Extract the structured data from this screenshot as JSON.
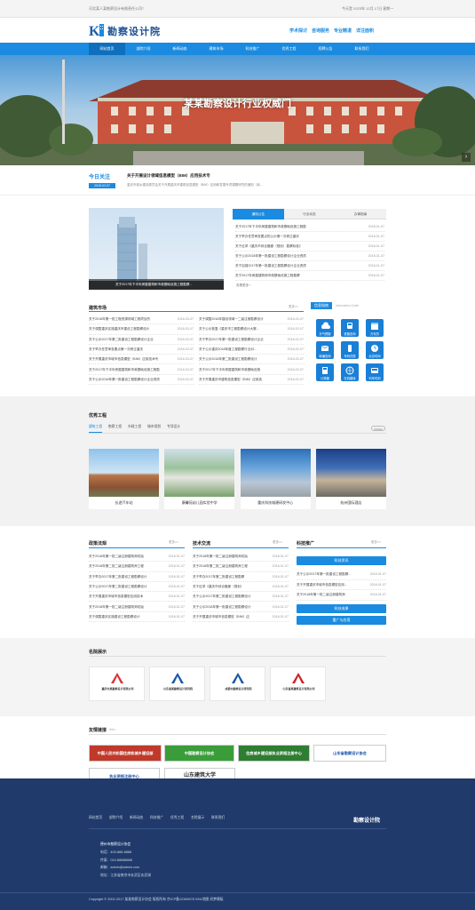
{
  "topbar": {
    "left": "河北某人某勘察设计有限责任公司！",
    "right": "今天是 2023年 12月 17日 星期一"
  },
  "header": {
    "logo_text": "勘察设计院",
    "slogans": [
      "学术探讨",
      "咨询服务",
      "专业精湛",
      "详注面积"
    ]
  },
  "nav": {
    "items": [
      "网站首页",
      "部院介绍",
      "新闻动态",
      "建筑市场",
      "科技推广",
      "优秀工程",
      "招聘公告",
      "联系我们"
    ],
    "active_index": 0
  },
  "banner": {
    "title": "某某勘察设计行业权威门"
  },
  "today": {
    "label": "今日关注",
    "date": "2018-02-07",
    "headline": "关于开展设计领域信息模型（BIM）应用技术专",
    "summary": "重庆市城乡建设委员会关于开展重庆市建筑信息模型（BIM）应用和发展专项课题研究的通知（渝..."
  },
  "featured": {
    "caption": "关于2017年下半年房屋建筑和市政基础设施工程勘察...",
    "tabs": [
      "通知公告",
      "行业动态",
      "办事指南"
    ],
    "active_tab": 0,
    "items": [
      {
        "text": "关于2017年下半年房屋建筑和市政基础设施工程勘",
        "date": "2018-01-07"
      },
      {
        "text": "关于举办任意审查要点的公示第一次修正重庆",
        "date": "2018-01-07"
      },
      {
        "text": "关于征求《重庆市综合管廊（规划）勘察标准》",
        "date": "2018-01-07"
      },
      {
        "text": "关于公示2018年第一批建设工程勘察设计企业资质",
        "date": "2018-01-07"
      },
      {
        "text": "关于加强2017年第一批建设工程勘察设计企业资质",
        "date": "2018-01-07"
      },
      {
        "text": "关于2017年房屋建筑和市政基础设施工程勘察",
        "date": "2018-01-07"
      }
    ],
    "more": "查看更多 ›"
  },
  "building_news": {
    "title": "建筑市场",
    "more": "更多>>",
    "left": [
      {
        "text": "关于2018年第一批工程资源领域工程项目的",
        "date": "2018-03-07"
      },
      {
        "text": "关于调整重庆实施重庆市建设工程勘察设计",
        "date": "2018-03-07"
      },
      {
        "text": "关于公示2017年第二批建设工程勘察设计企业",
        "date": "2018-03-07"
      },
      {
        "text": "关于举办任意审查要点第一次修正重庆",
        "date": "2018-03-07"
      },
      {
        "text": "关于开展重庆市城市信息模型（BIM）应用技术专",
        "date": "2018-03-07"
      },
      {
        "text": "关于2017年下半年房屋建筑和市政基础设施工程勘",
        "date": "2018-03-07"
      },
      {
        "text": "关于公示2018年第一批建设工程勘察设计企业资质",
        "date": "2018-03-07"
      }
    ],
    "right": [
      {
        "text": "关于调整2018年建设领域一二级注册勘察设计",
        "date": "2018-02-07"
      },
      {
        "text": "关于公示批复《重庆市工程勘察设计大赛...",
        "date": "2018-02-07"
      },
      {
        "text": "关于举办2017年第一批建设工程勘察设计企业",
        "date": "2018-02-07"
      },
      {
        "text": "关于公示重庆2018年度工程勘察行业对...",
        "date": "2018-02-07"
      },
      {
        "text": "关于公示2018年第二批建设工程勘察设计",
        "date": "2018-02-07"
      },
      {
        "text": "关于2017年下半年房屋建筑和市政基础设施",
        "date": "2018-02-07"
      },
      {
        "text": "关于开展重庆市建筑信息模型（BIM）应用技",
        "date": "2018-02-07"
      }
    ]
  },
  "info_guide": {
    "title": "信息指南",
    "subtitle": "Information Guide",
    "tiles": [
      {
        "icon": "cloud-icon",
        "label": "天气预报"
      },
      {
        "icon": "train-icon",
        "label": "铁路查询"
      },
      {
        "icon": "book-icon",
        "label": "万年历"
      },
      {
        "icon": "mail-icon",
        "label": "邮编查询"
      },
      {
        "icon": "phone-icon",
        "label": "号码归属"
      },
      {
        "icon": "clock-icon",
        "label": "北京时间"
      },
      {
        "icon": "calculator-icon",
        "label": "计算器"
      },
      {
        "icon": "globe-icon",
        "label": "在线翻译"
      },
      {
        "icon": "bus-icon",
        "label": "列车时刻"
      }
    ]
  },
  "excellent": {
    "title": "优秀工程",
    "tabs": [
      "建筑工程",
      "勘察工程",
      "市政工程",
      "城市规划",
      "专项设计"
    ],
    "active_tab": 0,
    "more": "MORE",
    "projects": [
      "长途汽车站",
      "康馨苑幼儿园实验中学",
      "重庆科技城建研发中心",
      "杭州国际酒店"
    ]
  },
  "policy": {
    "title": "政策法规",
    "more": "更多>>",
    "items": [
      {
        "text": "关于2018年第一批二级注册建筑师初始",
        "date": "2018-01-07"
      },
      {
        "text": "关于2018年第二批二级注册建筑师工程",
        "date": "2018-01-07"
      },
      {
        "text": "关于举办2017年第二批建设工程勘察设计",
        "date": "2018-01-07"
      },
      {
        "text": "关于公示2017年第二批建设工程勘察设计",
        "date": "2018-01-07"
      },
      {
        "text": "关于开展重庆市城市信息模型应用技术",
        "date": "2018-01-07"
      },
      {
        "text": "关于2018年第一批二级注册建筑师初始",
        "date": "2018-01-07"
      },
      {
        "text": "关于调整重庆实施建设工程勘察设计",
        "date": "2018-01-07"
      }
    ]
  },
  "tech": {
    "title": "技术交流",
    "more": "更多>>",
    "items": [
      {
        "text": "关于2018年第一批二级注册建筑师初始",
        "date": "2018-01-07"
      },
      {
        "text": "关于2018年第二批二级注册建筑师工程",
        "date": "2018-01-07"
      },
      {
        "text": "关于举办2017年第二批建设工程勘察",
        "date": "2018-01-07"
      },
      {
        "text": "关于征求《重庆市综合管廊（规划）",
        "date": "2018-01-07"
      },
      {
        "text": "关于公示2017年第二批建设工程勘察设计",
        "date": "2018-01-07"
      },
      {
        "text": "关于公示2018年第一批建设工程勘察设计",
        "date": "2018-01-07"
      },
      {
        "text": "关于开展重庆市城市信息模型（BIM）应",
        "date": "2018-01-07"
      }
    ]
  },
  "promo": {
    "title": "科技推广",
    "more": "更多>>",
    "buttons": [
      "科技资讯",
      "科技成果",
      "重广与应用"
    ],
    "items": [
      {
        "text": "关于公示2017年第一批建设工程勘察...",
        "date": "2018-01-07"
      },
      {
        "text": "关于开展重庆市城市信息模型应用...",
        "date": "2018-01-07"
      },
      {
        "text": "关于2018年第一批二级注册建筑师",
        "date": "2018-01-07"
      }
    ]
  },
  "famous": {
    "title": "名院展示",
    "logos": [
      "重庆市某勘察设计有限公司",
      "山东省某勘察设计研究院",
      "成都市勘察设计研究院",
      "山东省某建筑设计有限公司"
    ]
  },
  "links": {
    "title": "友情链接",
    "subtitle": "links",
    "boxes": [
      "中国人民共和国住房和城乡建设部",
      "中国勘察设计协会",
      "住房城乡建设部执业资格注册中心",
      "山东省勘察设计协会",
      "执业资格注册中心",
      "山东建筑大学"
    ]
  },
  "footer": {
    "nav": [
      "网站首页",
      "部院介绍",
      "新闻动态",
      "科技推广",
      "优秀工程",
      "名院展示",
      "联系我们"
    ],
    "brand": "勘察设计院",
    "company": "德州市勘察设计协会",
    "contact": [
      "电话：400-888-8888",
      "传真：010-88888888",
      "邮箱：admin@admin.com",
      "地址：江苏省南京市玄武区玄武湖"
    ],
    "copyright": "Copyright © 2002-2017 某某勘察设计协会 版权所有   京ICP备12345678  XML地图  织梦模板"
  },
  "colors": {
    "primary": "#1a8be0",
    "nav_active": "#0f6fbd",
    "footer": "#1f3a6b"
  }
}
